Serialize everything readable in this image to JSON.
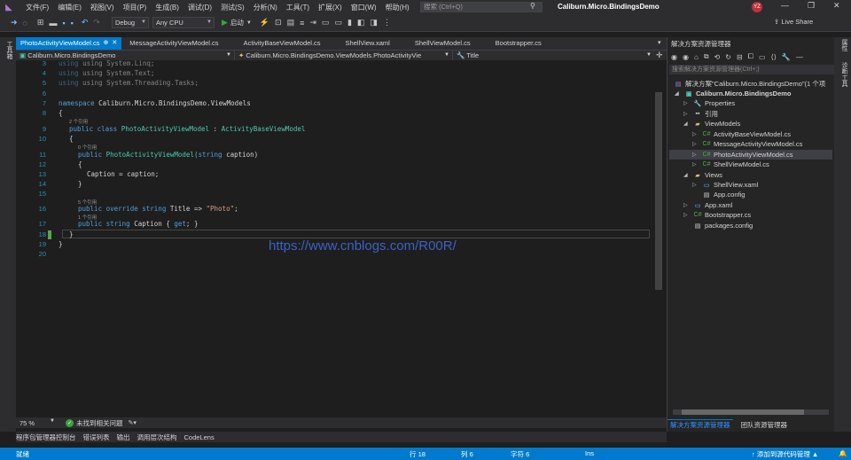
{
  "menu": [
    "文件(F)",
    "编辑(E)",
    "视图(V)",
    "项目(P)",
    "生成(B)",
    "调试(D)",
    "测试(S)",
    "分析(N)",
    "工具(T)",
    "扩展(X)",
    "窗口(W)",
    "帮助(H)"
  ],
  "search_placeholder": "搜索 (Ctrl+Q)",
  "solution_title": "Caliburn.Micro.BindingsDemo",
  "avatar_initials": "YZ",
  "toolbar": {
    "config": "Debug",
    "platform": "Any CPU",
    "start_label": "启动",
    "live_share": "Live Share"
  },
  "tabs": [
    {
      "label": "PhotoActivityViewModel.cs",
      "active": true
    },
    {
      "label": "MessageActivityViewModel.cs",
      "active": false
    },
    {
      "label": "ActivityBaseViewModel.cs",
      "active": false
    },
    {
      "label": "ShellView.xaml",
      "active": false
    },
    {
      "label": "ShellViewModel.cs",
      "active": false
    },
    {
      "label": "Bootstrapper.cs",
      "active": false
    }
  ],
  "navbar": {
    "project": "Caliburn.Micro.BindingsDemo",
    "type": "Caliburn.Micro.BindingsDemo.ViewModels.PhotoActivityVie",
    "member": "Title"
  },
  "line_numbers": [
    "3",
    "4",
    "5",
    "6",
    "7",
    "8",
    "9",
    "10",
    "11",
    "12",
    "13",
    "14",
    "15",
    "16",
    "17",
    "18",
    "19",
    "20"
  ],
  "code": {
    "l3": "using System.Linq;",
    "l4": "using System.Text;",
    "l5": "using System.Threading.Tasks;",
    "l7a": "namespace",
    "l7b": " Caliburn.Micro.BindingsDemo.ViewModels",
    "l8": "{",
    "ref9": "2 个引用",
    "l9a": "public class",
    "l9b": " PhotoActivityViewModel",
    "l9c": " : ",
    "l9d": "ActivityBaseViewModel",
    "l10": "{",
    "ref11": "0 个引用",
    "l11a": "public",
    "l11b": " PhotoActivityViewModel(",
    "l11c": "string",
    "l11d": " caption)",
    "l12": "{",
    "l13": "Caption = caption;",
    "l14": "}",
    "ref16": "5 个引用",
    "l16a": "public override string",
    "l16b": " Title => ",
    "l16c": "\"Photo\"",
    "l16d": ";",
    "ref17": "1 个引用",
    "l17a": "public string",
    "l17b": " Caption { ",
    "l17c": "get",
    "l17d": "; }",
    "l18": "}",
    "l19": "}"
  },
  "watermark": "https://www.cnblogs.com/R00R/",
  "editor_status": {
    "zoom": "75 %",
    "issues": "未找到相关问题"
  },
  "bottom_tabs": [
    "程序包管理器控制台",
    "错误列表",
    "输出",
    "调用层次结构",
    "CodeLens"
  ],
  "solution_explorer": {
    "title": "解决方案资源管理器",
    "search_placeholder": "搜索解决方案资源管理器(Ctrl+;)",
    "items": [
      {
        "label": "解决方案\"Caliburn.Micro.BindingsDemo\"(1 个项",
        "icon": "solution-icon"
      },
      {
        "label": "Caliburn.Micro.BindingsDemo",
        "icon": "csharp-project-icon",
        "bold": true
      },
      {
        "label": "Properties",
        "icon": "wrench-icon"
      },
      {
        "label": "引用",
        "icon": "references-icon"
      },
      {
        "label": "ViewModels",
        "icon": "folder-icon"
      },
      {
        "label": "ActivityBaseViewModel.cs",
        "icon": "csharp-file-icon"
      },
      {
        "label": "MessageActivityViewModel.cs",
        "icon": "csharp-file-icon"
      },
      {
        "label": "PhotoActivityViewModel.cs",
        "icon": "csharp-file-icon",
        "selected": true
      },
      {
        "label": "ShellViewModel.cs",
        "icon": "csharp-file-icon"
      },
      {
        "label": "Views",
        "icon": "folder-icon"
      },
      {
        "label": "ShellView.xaml",
        "icon": "xaml-file-icon"
      },
      {
        "label": "App.config",
        "icon": "config-file-icon"
      },
      {
        "label": "App.xaml",
        "icon": "xaml-file-icon"
      },
      {
        "label": "Bootstrapper.cs",
        "icon": "csharp-file-icon"
      },
      {
        "label": "packages.config",
        "icon": "config-file-icon"
      }
    ],
    "bottom_tabs": [
      "解决方案资源管理器",
      "团队资源管理器"
    ]
  },
  "side_strip_left": "工具箱",
  "side_strip_right": [
    "属性",
    "诊断工具"
  ],
  "statusbar": {
    "ready": "就绪",
    "line": "行 18",
    "col": "列 6",
    "char": "字符 6",
    "ins": "Ins",
    "source_control": "↑ 添加到源代码管理 ▲"
  },
  "colors": {
    "accent": "#007acc",
    "keyword": "#569cd6",
    "type": "#4ec9b0",
    "string": "#d69d85",
    "linenumber": "#2b91af"
  }
}
